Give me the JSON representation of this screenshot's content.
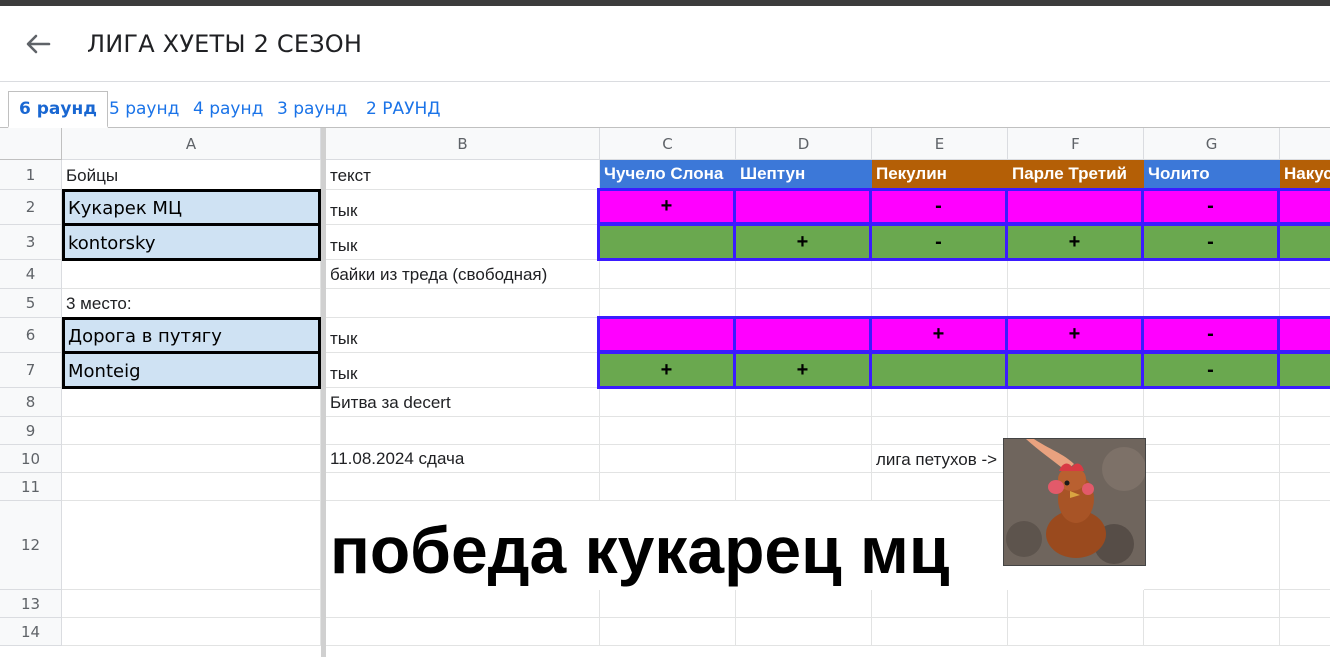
{
  "header": {
    "title": "ЛИГА ХУЕТЫ 2 СЕЗОН"
  },
  "tabs": [
    {
      "label": "6 раунд",
      "active": true
    },
    {
      "label": "5 раунд"
    },
    {
      "label": "4 раунд"
    },
    {
      "label": "3 раунд"
    },
    {
      "label": "2 РАУНД"
    }
  ],
  "columns": [
    "A",
    "B",
    "C",
    "D",
    "E",
    "F",
    "G"
  ],
  "rows": [
    "1",
    "2",
    "3",
    "4",
    "5",
    "6",
    "7",
    "8",
    "9",
    "10",
    "11",
    "12",
    "13",
    "14"
  ],
  "cells": {
    "a1": "Бойцы",
    "b1": "текст",
    "a2": "Кукарек МЦ",
    "b2": "тык",
    "a3": "kontorsky",
    "b3": "тык",
    "b4": "байки из треда (свободная)",
    "a5": "3 место:",
    "a6": "Дорога в путягу",
    "b6": "тык",
    "a7": "Monteig",
    "b7": "тык",
    "b8": "Битва за decert",
    "b10": "11.08.2024 сдача",
    "e10": "лига петухов ->",
    "b12": "победа кукарец мц"
  },
  "judges": [
    {
      "name": "Чучело Слона",
      "color": "#3c78d8"
    },
    {
      "name": "Шептун",
      "color": "#3c78d8"
    },
    {
      "name": "Пекулин",
      "color": "#b45f06"
    },
    {
      "name": "Парле Третий",
      "color": "#b45f06"
    },
    {
      "name": "Чолито",
      "color": "#3c78d8"
    },
    {
      "name": "Накус",
      "color": "#b45f06"
    }
  ],
  "votes": {
    "row2": [
      "+",
      "",
      "-",
      "",
      "-",
      ""
    ],
    "row3": [
      "",
      "+",
      "-",
      "+",
      "-",
      ""
    ],
    "row6": [
      "",
      "",
      "+",
      "+",
      "-",
      ""
    ],
    "row7": [
      "+",
      "+",
      "",
      "",
      "-",
      ""
    ]
  },
  "colors": {
    "magenta": "#ff00ff",
    "green": "#6aa84f",
    "vote_border": "#3b1bff",
    "fighter_bg": "#cfe2f3"
  }
}
